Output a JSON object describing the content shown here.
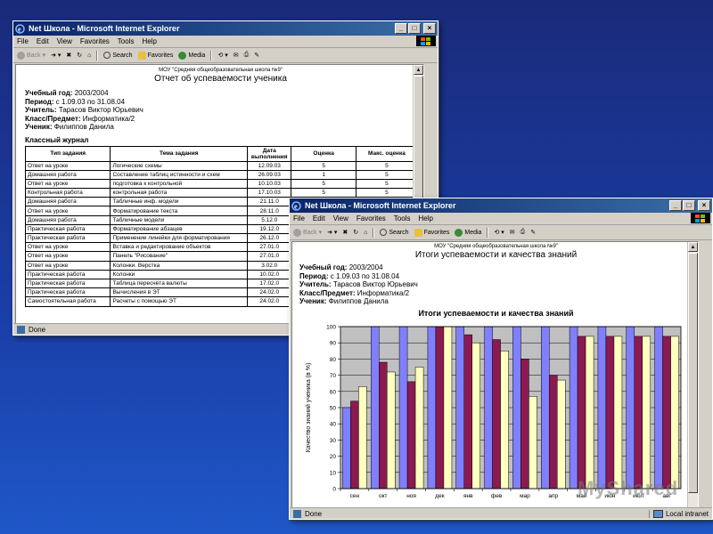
{
  "background": {
    "color_top": "#1a2a7a",
    "color_bottom": "#1f57c8"
  },
  "window1": {
    "title": "Net Школа - Microsoft Internet Explorer",
    "menu": [
      "File",
      "Edit",
      "View",
      "Favorites",
      "Tools",
      "Help"
    ],
    "toolbar": {
      "back": "Back",
      "search": "Search",
      "favorites": "Favorites",
      "media": "Media"
    },
    "status": "Done",
    "doc": {
      "school": "МОУ \"Средняя общеобразовательная школа №9\"",
      "title": "Отчет об успеваемости ученика",
      "year_label": "Учебный год:",
      "year": "2003/2004",
      "period_label": "Период:",
      "period": "с 1.09.03 по 31.08.04",
      "teacher_label": "Учитель:",
      "teacher": "Тарасов Виктор Юрьевич",
      "class_label": "Класс/Предмет:",
      "class": "Информатика/2",
      "student_label": "Ученик:",
      "student": "Филиппов Данила",
      "journal_heading": "Классный журнал",
      "columns": [
        "Тип задания",
        "Тема задания",
        "Дата выполнения",
        "Оценка",
        "Макс. оценка"
      ],
      "rows": [
        [
          "Ответ на уроке",
          "Логические схемы",
          "12.09.03",
          "5",
          "5"
        ],
        [
          "Домашняя работа",
          "Составление таблиц истинности и схем",
          "26.09.03",
          "1",
          "5"
        ],
        [
          "Ответ на уроке",
          "подготовка к контрольной",
          "10.10.03",
          "5",
          "5"
        ],
        [
          "Контрольная работа",
          "контрольная работа",
          "17.10.03",
          "5",
          "5"
        ],
        [
          "Домашняя работа",
          "Табличные инф. модели",
          "21.11.0",
          "",
          ""
        ],
        [
          "Ответ на уроке",
          "Форматирование текста",
          "28.11.0",
          "",
          ""
        ],
        [
          "Домашняя работа",
          "Табличные модели",
          "5.12.0",
          "",
          ""
        ],
        [
          "Практическая работа",
          "Форматирование абзацев",
          "19.12.0",
          "",
          ""
        ],
        [
          "Практическая работа",
          "Применение линейки для форматирования",
          "26.12.0",
          "",
          ""
        ],
        [
          "Ответ на уроке",
          "Вставка и редактирование объектов",
          "27.01.0",
          "",
          ""
        ],
        [
          "Ответ на уроке",
          "Панель \"Рисование\"",
          "27.01.0",
          "",
          ""
        ],
        [
          "Ответ на уроке",
          "Колонки. Верстка",
          "3.02.0",
          "",
          ""
        ],
        [
          "Практическая работа",
          "Колонки",
          "10.02.0",
          "",
          ""
        ],
        [
          "Практическая работа",
          "Таблица пересчёта валюты",
          "17.02.0",
          "",
          ""
        ],
        [
          "Практическая работа",
          "Вычисления в ЭТ",
          "24.02.0",
          "",
          ""
        ],
        [
          "Самостоятельная работа",
          "Расчеты с помощью ЭТ",
          "24.02.0",
          "",
          ""
        ]
      ]
    }
  },
  "window2": {
    "title": "Net Школа - Microsoft Internet Explorer",
    "menu": [
      "File",
      "Edit",
      "View",
      "Favorites",
      "Tools",
      "Help"
    ],
    "toolbar": {
      "back": "Back",
      "search": "Search",
      "favorites": "Favorites",
      "media": "Media"
    },
    "status": "Done",
    "zone": "Local intranet",
    "doc": {
      "school": "МОУ \"Средняя общеобразовательная школа №9\"",
      "title": "Итоги успеваемости и качества знаний",
      "year_label": "Учебный год:",
      "year": "2003/2004",
      "period_label": "Период:",
      "period": "с 1.09.03 по 31.08.04",
      "teacher_label": "Учитель:",
      "teacher": "Тарасов Виктор Юрьевич",
      "class_label": "Класс/Предмет:",
      "class": "Информатика/2",
      "student_label": "Ученик:",
      "student": "Филиппов Данила"
    }
  },
  "watermark": "MyShared",
  "chart_data": {
    "type": "bar",
    "title": "Итоги успеваемости и качества знаний",
    "ylabel": "Качество знаний ученика (в %)",
    "xlabel": "",
    "ylim": [
      0,
      100
    ],
    "yticks": [
      0,
      10,
      20,
      30,
      40,
      50,
      60,
      70,
      80,
      90,
      100
    ],
    "grid": true,
    "categories": [
      "сен",
      "окт",
      "ноя",
      "дек",
      "янв",
      "фев",
      "мар",
      "апр",
      "май",
      "июн",
      "июл",
      "авг"
    ],
    "series": [
      {
        "color": "#8080ff",
        "values": [
          50,
          100,
          100,
          100,
          100,
          100,
          100,
          100,
          100,
          100,
          100,
          100
        ]
      },
      {
        "color": "#8b1a50",
        "values": [
          54,
          78,
          66,
          100,
          95,
          92,
          80,
          70,
          94,
          94,
          94,
          94
        ]
      },
      {
        "color": "#ffffc0",
        "values": [
          63,
          72,
          75,
          100,
          90,
          85,
          57,
          67,
          94,
          94,
          94,
          94
        ]
      }
    ]
  }
}
